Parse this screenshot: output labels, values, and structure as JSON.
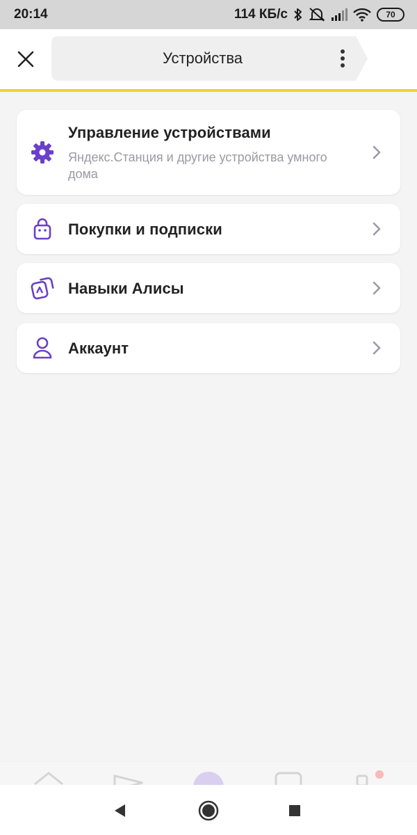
{
  "status_bar": {
    "time": "20:14",
    "net_speed": "114 КБ/с",
    "battery_level": "70",
    "icons": [
      "bluetooth-icon",
      "mute-icon",
      "signal-icon",
      "wifi-icon",
      "battery-icon"
    ]
  },
  "header": {
    "title": "Устройства",
    "close_icon": "close-icon",
    "menu_icon": "more-vertical-icon"
  },
  "menu": {
    "items": [
      {
        "label": "Управление устройствами",
        "sublabel": "Яндекс.Станция и другие устройства умного дома",
        "icon": "gear-icon"
      },
      {
        "label": "Покупки и подписки",
        "icon": "shopping-bag-icon"
      },
      {
        "label": "Навыки Алисы",
        "icon": "skills-icon"
      },
      {
        "label": "Аккаунт",
        "icon": "account-icon"
      }
    ]
  },
  "tabbar": {
    "tabs": [
      "home-icon",
      "feed-icon",
      "alice-icon",
      "calendar-icon",
      "services-icon"
    ]
  },
  "navbar": {
    "buttons": [
      "back-icon",
      "home-circle-icon",
      "recents-icon"
    ]
  },
  "colors": {
    "accent_yellow": "#f7cf2b",
    "icon_purple": "#6b3fc9",
    "chevron_gray": "#9a9aa8",
    "background": "#f4f4f4"
  }
}
